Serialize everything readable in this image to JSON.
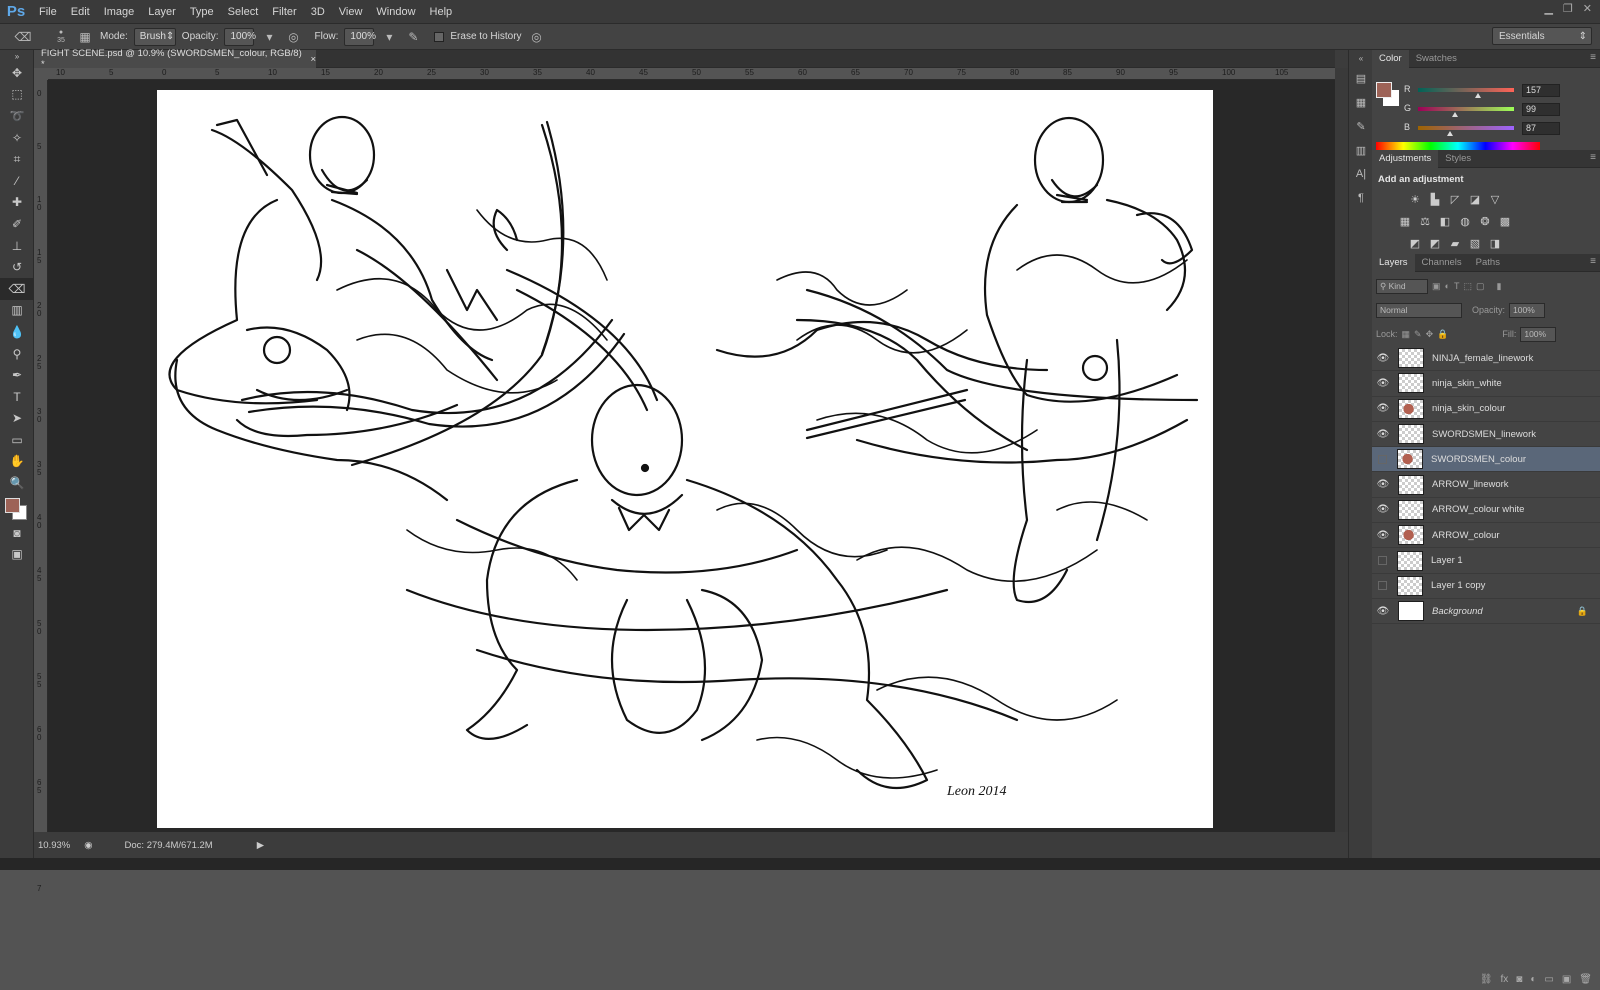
{
  "app": {
    "logo": "Ps"
  },
  "menu": [
    "File",
    "Edit",
    "Image",
    "Layer",
    "Type",
    "Select",
    "Filter",
    "3D",
    "View",
    "Window",
    "Help"
  ],
  "options": {
    "brush_size": "35",
    "mode_label": "Mode:",
    "mode_value": "Brush",
    "opacity_label": "Opacity:",
    "opacity_value": "100%",
    "flow_label": "Flow:",
    "flow_value": "100%",
    "erase_history_label": "Erase to History",
    "workspace": "Essentials"
  },
  "document": {
    "tab_title": "FIGHT SCENE.psd @ 10.9% (SWORDSMEN_colour, RGB/8) *",
    "close": "×",
    "ruler_h": [
      "10",
      "5",
      "0",
      "5",
      "10",
      "15",
      "20",
      "25",
      "30",
      "35",
      "40",
      "45",
      "50",
      "55",
      "60",
      "65",
      "70",
      "75",
      "80",
      "85",
      "90",
      "95",
      "100",
      "105"
    ],
    "ruler_v": [
      "0",
      "5",
      "1 0",
      "1 5",
      "2 0",
      "2 5",
      "3 0",
      "3 5",
      "4 0",
      "4 5",
      "5 0",
      "5 5",
      "6 0",
      "6 5",
      "7 0",
      "7"
    ]
  },
  "status": {
    "zoom": "10.93%",
    "doc": "Doc: 279.4M/671.2M"
  },
  "panels": {
    "color": {
      "tabs": [
        "Color",
        "Swatches"
      ],
      "r_label": "R",
      "r": "157",
      "g_label": "G",
      "g": "99",
      "b_label": "B",
      "b": "87",
      "fg_color": "#9d6357"
    },
    "adjustments": {
      "tabs": [
        "Adjustments",
        "Styles"
      ],
      "title": "Add an adjustment"
    },
    "layers": {
      "tabs": [
        "Layers",
        "Channels",
        "Paths"
      ],
      "kind": "Kind",
      "blend": "Normal",
      "opacity_label": "Opacity:",
      "opacity": "100%",
      "lock_label": "Lock:",
      "fill_label": "Fill:",
      "fill": "100%",
      "items": [
        {
          "name": "NINJA_female_linework",
          "visible": true
        },
        {
          "name": "ninja_skin_white",
          "visible": true
        },
        {
          "name": "ninja_skin_colour",
          "visible": true
        },
        {
          "name": "SWORDSMEN_linework",
          "visible": true
        },
        {
          "name": "SWORDSMEN_colour",
          "visible": false,
          "selected": true
        },
        {
          "name": "ARROW_linework",
          "visible": true
        },
        {
          "name": "ARROW_colour white",
          "visible": true
        },
        {
          "name": "ARROW_colour",
          "visible": true
        },
        {
          "name": "Layer 1",
          "visible": false
        },
        {
          "name": "Layer 1 copy",
          "visible": false
        },
        {
          "name": "Background",
          "visible": true,
          "locked": true
        }
      ]
    }
  },
  "artwork": {
    "signature": "Leon 2014"
  }
}
